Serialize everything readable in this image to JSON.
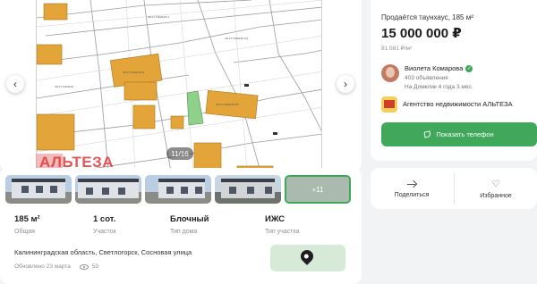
{
  "gallery": {
    "counter": "11/16",
    "watermark": "АЛЬТЕЗА",
    "prev_icon": "chevron-left-icon",
    "next_icon": "chevron-right-icon",
    "thumbs_more": "+11"
  },
  "params": [
    {
      "value": "185 м²",
      "label": "Общая"
    },
    {
      "value": "1 сот.",
      "label": "Участок"
    },
    {
      "value": "Блочный",
      "label": "Тип дома"
    },
    {
      "value": "ИЖС",
      "label": "Тип участка"
    }
  ],
  "location": {
    "address": "Калининградская область, Светлогорск, Сосновая улица",
    "updated": "Обновлено 23 марта",
    "views": "53"
  },
  "listing": {
    "title": "Продаётся таунхаус, 185 м²",
    "price": "15 000 000 ₽",
    "price_per_m": "81 081 ₽/м²"
  },
  "agent": {
    "name": "Виолета Комарова",
    "listings": "403 объявления",
    "since": "На Домклик 4 года 3 мес.",
    "verified_icon": "check-icon"
  },
  "agency": {
    "name": "Агентство недвижимости АЛЬТЕЗА"
  },
  "actions": {
    "call_label": "Показать телефон",
    "share_label": "Поделиться",
    "favorite_label": "Избранное"
  },
  "colors": {
    "accent": "#3fa85b",
    "background": "#f2f3f5",
    "watermark": "#e03a3a"
  }
}
